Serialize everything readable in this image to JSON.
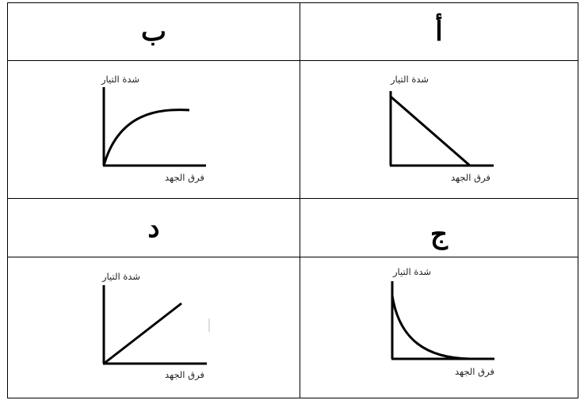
{
  "table": {
    "headers": {
      "top_right": "أ",
      "top_left": "ب",
      "bottom_right": "ج",
      "bottom_left": "د"
    },
    "graphs": {
      "a": {
        "y_label": "شدة التيار",
        "x_label": "فرق الجهد",
        "curve": "decreasing-linear"
      },
      "b": {
        "y_label": "شدة التيار",
        "x_label": "فرق الجهد",
        "curve": "increasing-saturating"
      },
      "c": {
        "y_label": "شدة التيار",
        "x_label": "فرق الجهد",
        "curve": "decreasing-concave"
      },
      "d": {
        "y_label": "شدة التيار",
        "x_label": "فرق الجهد",
        "curve": "increasing-linear"
      }
    }
  }
}
